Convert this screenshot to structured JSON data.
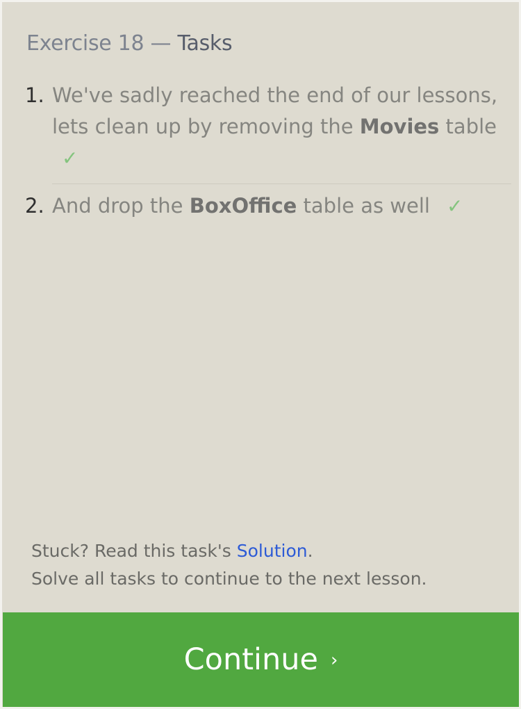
{
  "header": {
    "exercise_label": "Exercise 18",
    "separator": "—",
    "section": "Tasks"
  },
  "tasks": [
    {
      "number": "1.",
      "text_before": "We've sadly reached the end of our lessons, lets clean up by removing the ",
      "bold": "Movies",
      "text_after": " table",
      "status_symbol": "✓"
    },
    {
      "number": "2.",
      "text_before": "And drop the ",
      "bold": "BoxOffice",
      "text_after": " table as well",
      "status_symbol": "✓"
    }
  ],
  "footer": {
    "stuck_prefix": "Stuck? Read this task's ",
    "solution_link": "Solution",
    "stuck_suffix": ".",
    "instruction": "Solve all tasks to continue to the next lesson."
  },
  "continue_button": {
    "label": "Continue",
    "arrow": "›"
  },
  "colors": {
    "panel_bg": "#dedbd0",
    "button_bg": "#51a840",
    "check": "#84c47e",
    "link": "#2d5bd6"
  }
}
